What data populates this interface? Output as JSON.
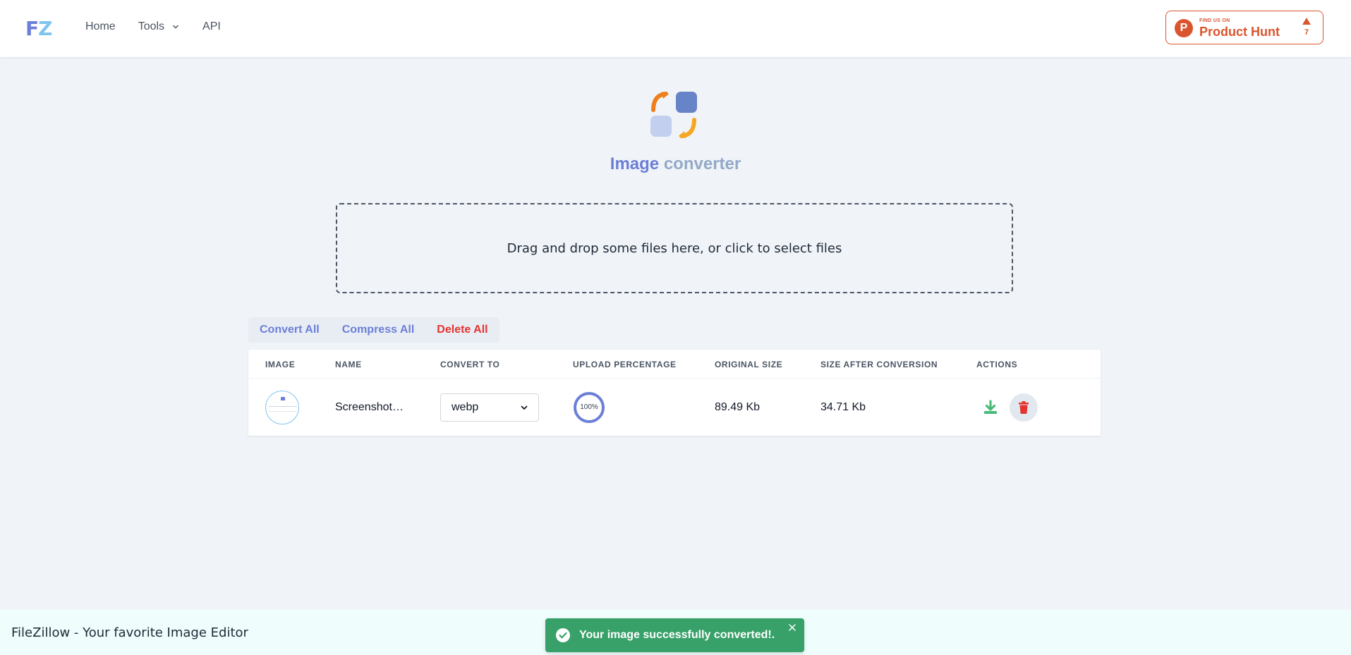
{
  "header": {
    "logo_f": "F",
    "logo_z": "Z",
    "nav": [
      {
        "label": "Home"
      },
      {
        "label": "Tools"
      },
      {
        "label": "API"
      }
    ],
    "producthunt": {
      "small": "FIND US ON",
      "big": "Product Hunt",
      "letter": "P",
      "count": "7"
    }
  },
  "hero": {
    "title_part1": "Image",
    "title_part2": "converter"
  },
  "dropzone": {
    "text": "Drag and drop some files here, or click to select files"
  },
  "bulk_actions": {
    "convert_all": "Convert All",
    "compress_all": "Compress All",
    "delete_all": "Delete All"
  },
  "table": {
    "headers": [
      "IMAGE",
      "NAME",
      "CONVERT TO",
      "UPLOAD PERCENTAGE",
      "ORIGINAL SIZE",
      "SIZE AFTER CONVERSION",
      "ACTIONS"
    ],
    "rows": [
      {
        "name": "Screenshot…",
        "convert_to": "webp",
        "upload_percentage": "100%",
        "upload_fraction": 1.0,
        "original_size": "89.49 Kb",
        "size_after": "34.71 Kb"
      }
    ]
  },
  "footer": {
    "text": "FileZillow - Your favorite Image Editor"
  },
  "toast": {
    "message": "Your image successfully converted!."
  },
  "colors": {
    "brand": "#6c7fd8",
    "accent_light": "#7fc4ef",
    "danger": "#e3342f",
    "success": "#38a169",
    "producthunt": "#da552f",
    "background": "#f0f4f8"
  },
  "icons": {
    "download": "download-icon",
    "delete": "trash-icon",
    "toast": "check-circle-icon",
    "close": "close-icon",
    "chevron": "chevron-down-icon"
  }
}
